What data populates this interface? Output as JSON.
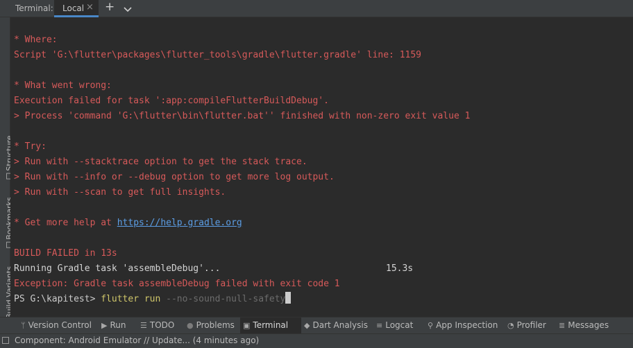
{
  "topbar": {
    "title": "Terminal:",
    "tab_label": "Local",
    "close_glyph": "×",
    "add_glyph": "+",
    "icons": [
      "close-icon",
      "plus-icon",
      "chevron-down-icon"
    ]
  },
  "left_tools": [
    {
      "label": "Structure",
      "icon": "structure-icon"
    },
    {
      "label": "Bookmarks",
      "icon": "bookmark-icon"
    },
    {
      "label": "Build Variants",
      "icon": "build-variants-icon"
    }
  ],
  "terminal": {
    "lines": [
      "* Where:",
      "Script 'G:\\flutter\\packages\\flutter_tools\\gradle\\flutter.gradle' line: 1159",
      "* What went wrong:",
      "Execution failed for task ':app:compileFlutterBuildDebug'.",
      "> Process 'command 'G:\\flutter\\bin\\flutter.bat'' finished with non-zero exit value 1",
      "* Try:",
      "> Run with --stacktrace option to get the stack trace.",
      "> Run with --info or --debug option to get more log output.",
      "> Run with --scan to get full insights.",
      "BUILD FAILED in 13s",
      "Running Gradle task 'assembleDebug'...",
      "Exception: Gradle task assembleDebug failed with exit code 1"
    ],
    "help_prefix": "* Get more help at ",
    "help_link": "https://help.gradle.org",
    "task_time": "15.3s",
    "prompt": "PS G:\\kapitest> ",
    "command": "flutter run",
    "command_hint": " --no-sound-null-safety"
  },
  "tool_windows": [
    {
      "label": "Version Control",
      "icon": "version-control-icon",
      "glyph": "ᛘ"
    },
    {
      "label": "Run",
      "icon": "run-icon",
      "glyph": "▶"
    },
    {
      "label": "TODO",
      "icon": "todo-icon",
      "glyph": "☰"
    },
    {
      "label": "Problems",
      "icon": "problems-icon",
      "glyph": "●"
    },
    {
      "label": "Terminal",
      "icon": "terminal-icon",
      "glyph": "▣"
    },
    {
      "label": "Dart Analysis",
      "icon": "dart-analysis-icon",
      "glyph": "◆"
    },
    {
      "label": "Logcat",
      "icon": "logcat-icon",
      "glyph": "≡"
    },
    {
      "label": "App Inspection",
      "icon": "app-inspection-icon",
      "glyph": "⚲"
    },
    {
      "label": "Profiler",
      "icon": "profiler-icon",
      "glyph": "◔"
    },
    {
      "label": "Messages",
      "icon": "messages-icon",
      "glyph": "≣"
    }
  ],
  "status": {
    "text": "Component: Android Emulator // Update... (4 minutes ago)"
  },
  "colors": {
    "error_red": "#d75a5a",
    "link_blue": "#5c9ee6",
    "command_yellow": "#cfc66a",
    "accent_tab": "#4a88c7"
  }
}
